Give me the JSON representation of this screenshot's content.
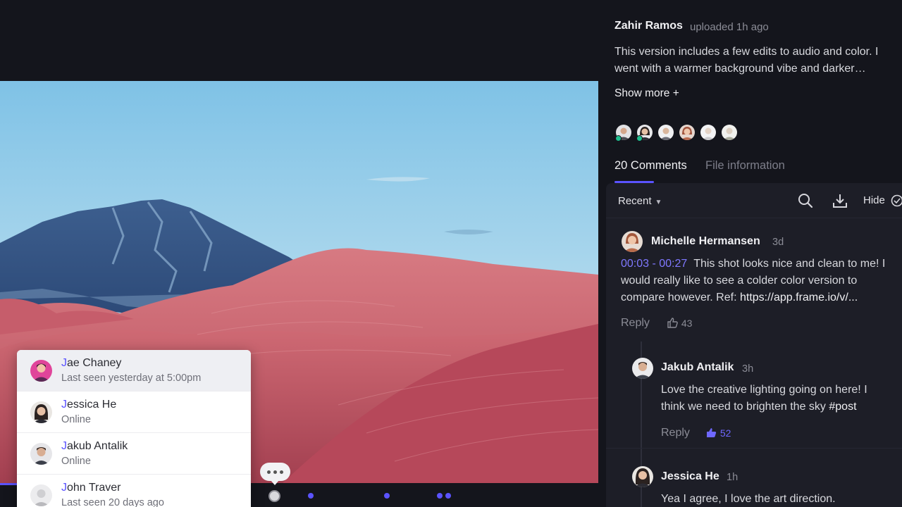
{
  "upload": {
    "uploader": "Zahir Ramos",
    "uploaded": "uploaded 1h ago",
    "description": "This version includes a few edits to audio and color. I went with a warmer background vibe and darker…",
    "show_more": "Show more +"
  },
  "tabs": {
    "comments": "20 Comments",
    "file_info": "File information"
  },
  "toolbar": {
    "sort": "Recent",
    "hide": "Hide"
  },
  "comments": [
    {
      "author": "Michelle Hermansen",
      "time": "3d",
      "timecode": "00:03 - 00:27",
      "text_line1": "This shot looks nice and clean to me! I",
      "text_line2": "would really like to see a colder color version to",
      "text_line3_prefix": "compare however. Ref: ",
      "text_line3_link": "https://app.frame.io/v/...",
      "reply": "Reply",
      "likes": "43"
    },
    {
      "author": "Jakub Antalik",
      "time": "3h",
      "text_line1": "Love the creative lighting going on here! I",
      "text_line2_prefix": "think we need to brighten the sky ",
      "text_line2_tag": "#post",
      "reply": "Reply",
      "likes": "52"
    },
    {
      "author": "Jessica He",
      "time": "1h",
      "text_line1": "Yea I agree, I love the art direction."
    }
  ],
  "mentions": [
    {
      "initial": "J",
      "rest": "ae Chaney",
      "status": "Last seen yesterday at 5:00pm"
    },
    {
      "initial": "J",
      "rest": "essica He",
      "status": "Online"
    },
    {
      "initial": "J",
      "rest": "akub Antalik",
      "status": "Online"
    },
    {
      "initial": "J",
      "rest": "ohn Traver",
      "status": "Last seen 20 days ago"
    }
  ],
  "colors": {
    "accent": "#5b53ff",
    "background": "#14151c",
    "panel": "#1d1e27",
    "online": "#1fbf8f"
  }
}
